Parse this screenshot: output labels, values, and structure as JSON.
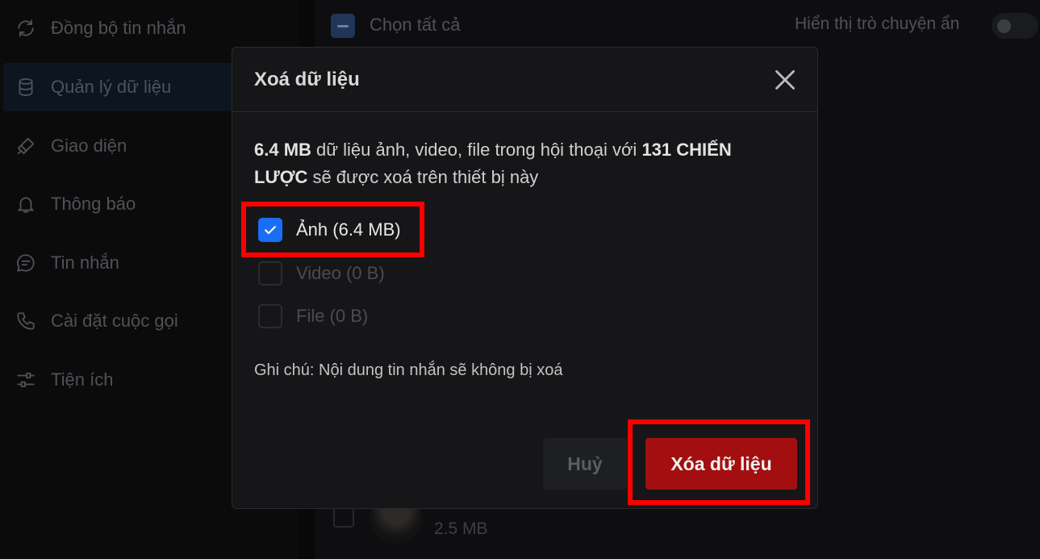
{
  "sidebar": {
    "items": [
      {
        "label": "Đồng bộ tin nhắn",
        "icon": "sync-icon"
      },
      {
        "label": "Quản lý dữ liệu",
        "icon": "database-icon"
      },
      {
        "label": "Giao diện",
        "icon": "brush-icon"
      },
      {
        "label": "Thông báo",
        "icon": "bell-icon"
      },
      {
        "label": "Tin nhắn",
        "icon": "chat-icon"
      },
      {
        "label": "Cài đặt cuộc gọi",
        "icon": "phone-icon"
      },
      {
        "label": "Tiện ích",
        "icon": "sliders-icon"
      }
    ],
    "active_index": 1
  },
  "main": {
    "select_all_label": "Chọn tất cả",
    "show_hidden_label": "Hiển thị trò chuyện ẩn",
    "row_size": "2.5 MB"
  },
  "modal": {
    "title": "Xoá dữ liệu",
    "desc_size": "6.4 MB",
    "desc_mid": " dữ liệu ảnh, video, file trong hội thoại với ",
    "desc_name": "131 CHIẾN LƯỢC",
    "desc_end": " sẽ được xoá trên thiết bị này",
    "options": [
      {
        "label": "Ảnh (6.4 MB)",
        "checked": true
      },
      {
        "label": "Video (0 B)",
        "checked": false
      },
      {
        "label": "File (0 B)",
        "checked": false
      }
    ],
    "note": "Ghi chú: Nội dung tin nhắn sẽ không bị xoá",
    "cancel_label": "Huỷ",
    "delete_label": "Xóa dữ liệu"
  },
  "colors": {
    "accent": "#1a6df5",
    "danger": "#a30f10",
    "highlight": "#ff0000"
  }
}
